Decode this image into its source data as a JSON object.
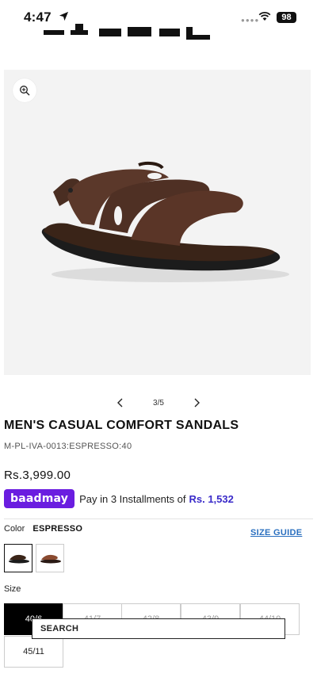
{
  "status_bar": {
    "time": "4:47",
    "battery": "98"
  },
  "gallery": {
    "counter": "3/5"
  },
  "product": {
    "title": "MEN'S CASUAL COMFORT SANDALS",
    "sku": "M-PL-IVA-0013:ESPRESSO:40",
    "price": "Rs.3,999.00"
  },
  "installments": {
    "provider": "baadmay",
    "text": "Pay in 3 Installments of",
    "amount": "Rs. 1,532"
  },
  "color": {
    "label": "Color",
    "value": "ESPRESSO",
    "swatches": [
      {
        "name": "espresso",
        "selected": true
      },
      {
        "name": "tan",
        "selected": false
      }
    ]
  },
  "size_guide": {
    "label": "SIZE GUIDE"
  },
  "size": {
    "label": "Size",
    "options": [
      {
        "label": "40/6",
        "selected": true
      },
      {
        "label": "41/7",
        "selected": false
      },
      {
        "label": "42/8",
        "selected": false
      },
      {
        "label": "43/9",
        "selected": false
      },
      {
        "label": "44/10",
        "selected": false
      },
      {
        "label": "45/11",
        "selected": false
      }
    ]
  },
  "search": {
    "label": "SEARCH"
  },
  "colors": {
    "accent": "#2a6fbf",
    "baadmay": "#6a1de0",
    "installment_amount": "#3a2bc9"
  }
}
